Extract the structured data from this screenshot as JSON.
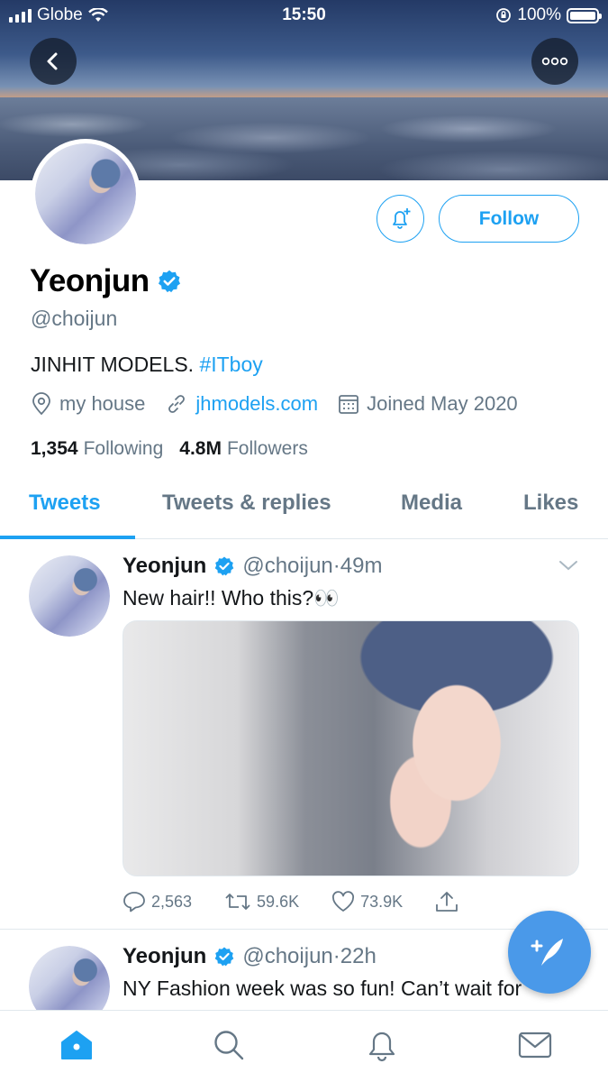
{
  "status_bar": {
    "carrier": "Globe",
    "time": "15:50",
    "battery": "100%"
  },
  "profile": {
    "display_name": "Yeonjun",
    "handle": "@choijun",
    "bio_text": "JINHIT MODELS. ",
    "bio_hashtag": "#ITboy",
    "location": "my house",
    "website": "jhmodels.com",
    "joined": "Joined May 2020",
    "following_count": "1,354",
    "following_label": "Following",
    "followers_count": "4.8M",
    "followers_label": "Followers",
    "follow_button": "Follow"
  },
  "tabs": [
    {
      "label": "Tweets",
      "active": true
    },
    {
      "label": "Tweets & replies",
      "active": false
    },
    {
      "label": "Media",
      "active": false
    },
    {
      "label": "Likes",
      "active": false
    }
  ],
  "tweets": [
    {
      "name": "Yeonjun",
      "handle": "@choijun",
      "time": "49m",
      "text": "New hair!! Who this?👀",
      "replies": "2,563",
      "retweets": "59.6K",
      "likes": "73.9K"
    },
    {
      "name": "Yeonjun",
      "handle": "@choijun",
      "time": "22h",
      "text": "NY Fashion week was so fun! Can’t wait for"
    }
  ],
  "colors": {
    "accent": "#1da1f2",
    "muted": "#657786",
    "fab": "#4a99e9"
  },
  "icons": {
    "back": "back-arrow-icon",
    "more": "more-icon",
    "bell": "bell-plus-icon",
    "verified": "verified-badge-icon",
    "location": "location-icon",
    "link": "link-icon",
    "calendar": "calendar-icon",
    "reply": "reply-icon",
    "retweet": "retweet-icon",
    "like": "heart-icon",
    "share": "share-icon",
    "compose": "compose-icon",
    "home": "home-icon",
    "search": "search-icon",
    "notifications": "notifications-icon",
    "messages": "messages-icon"
  }
}
